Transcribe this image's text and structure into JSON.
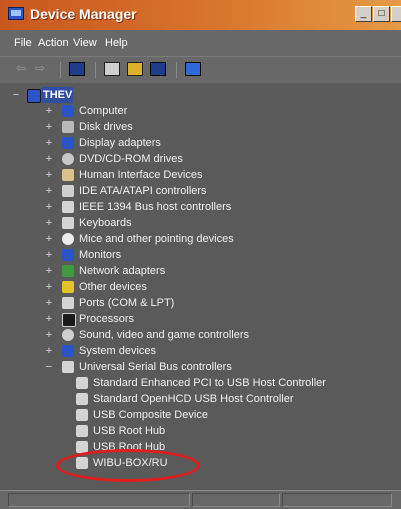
{
  "window": {
    "title": "Device Manager",
    "buttons": {
      "minimize": "_",
      "maximize": "□"
    }
  },
  "menu": {
    "items": [
      {
        "label": "File"
      },
      {
        "label": "Action"
      },
      {
        "label": "View"
      },
      {
        "label": "Help"
      }
    ]
  },
  "toolbar": {
    "buttons": [
      {
        "name": "back-icon",
        "glyph": "⇦"
      },
      {
        "name": "forward-icon",
        "glyph": "⇨"
      },
      {
        "name": "properties-icon"
      },
      {
        "name": "print-icon"
      },
      {
        "name": "help-icon"
      },
      {
        "name": "refresh-icon"
      },
      {
        "name": "scan-hardware-icon"
      }
    ]
  },
  "tree": {
    "root": {
      "label": "THEV",
      "expander": "−"
    },
    "categories": [
      {
        "label": "Computer",
        "expander": "+"
      },
      {
        "label": "Disk drives",
        "expander": "+"
      },
      {
        "label": "Display adapters",
        "expander": "+"
      },
      {
        "label": "DVD/CD-ROM drives",
        "expander": "+"
      },
      {
        "label": "Human Interface Devices",
        "expander": "+"
      },
      {
        "label": "IDE ATA/ATAPI controllers",
        "expander": "+"
      },
      {
        "label": "IEEE 1394 Bus host controllers",
        "expander": "+"
      },
      {
        "label": "Keyboards",
        "expander": "+"
      },
      {
        "label": "Mice and other pointing devices",
        "expander": "+"
      },
      {
        "label": "Monitors",
        "expander": "+"
      },
      {
        "label": "Network adapters",
        "expander": "+"
      },
      {
        "label": "Other devices",
        "expander": "+"
      },
      {
        "label": "Ports (COM & LPT)",
        "expander": "+"
      },
      {
        "label": "Processors",
        "expander": "+"
      },
      {
        "label": "Sound, video and game controllers",
        "expander": "+"
      },
      {
        "label": "System devices",
        "expander": "+"
      },
      {
        "label": "Universal Serial Bus controllers",
        "expander": "−"
      }
    ],
    "usb_children": [
      {
        "label": "Standard Enhanced PCI to USB Host Controller"
      },
      {
        "label": "Standard OpenHCD USB Host Controller"
      },
      {
        "label": "USB Composite Device"
      },
      {
        "label": "USB Root Hub"
      },
      {
        "label": "USB Root Hub"
      },
      {
        "label": "WIBU-BOX/RU"
      }
    ]
  },
  "colors": {
    "titlebar": "#d8752d",
    "selection": "#2f4ea0",
    "highlight_ring": "#e01d1d",
    "text": "#f0f0f0"
  }
}
